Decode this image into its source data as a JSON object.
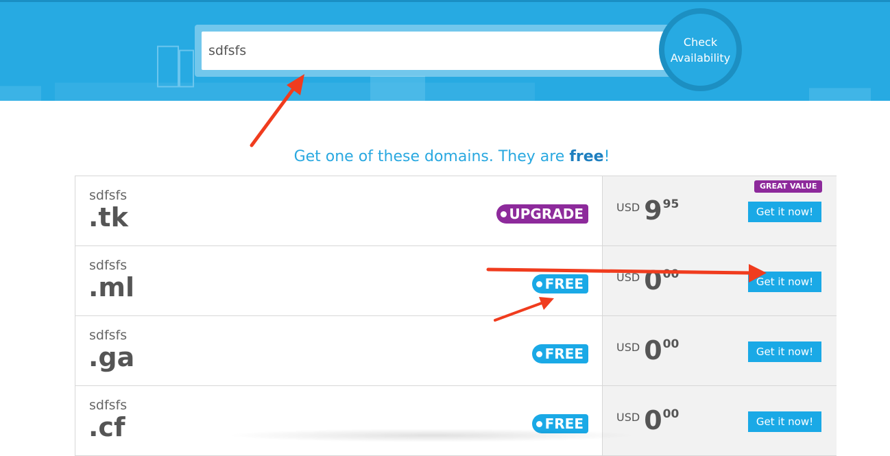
{
  "search": {
    "value": "sdfsfs"
  },
  "check_button": {
    "line1": "Check",
    "line2": "Availability"
  },
  "headline": {
    "prefix": "Get one of these domains. They are ",
    "bold": "free",
    "suffix": "!"
  },
  "rows": [
    {
      "name": "sdfsfs",
      "tld": ".tk",
      "badge": "UPGRADE",
      "currency": "USD",
      "price_int": "9",
      "price_dec": "95",
      "tag": "GREAT VALUE",
      "button": "Get it now!"
    },
    {
      "name": "sdfsfs",
      "tld": ".ml",
      "badge": "FREE",
      "currency": "USD",
      "price_int": "0",
      "price_dec": "00",
      "button": "Get it now!"
    },
    {
      "name": "sdfsfs",
      "tld": ".ga",
      "badge": "FREE",
      "currency": "USD",
      "price_int": "0",
      "price_dec": "00",
      "button": "Get it now!"
    },
    {
      "name": "sdfsfs",
      "tld": ".cf",
      "badge": "FREE",
      "currency": "USD",
      "price_int": "0",
      "price_dec": "00",
      "button": "Get it now!"
    }
  ],
  "colors": {
    "header": "#27aae2",
    "accent": "#1aa9e6",
    "upgrade": "#8d2a9b",
    "annotation": "#f03c1e"
  }
}
